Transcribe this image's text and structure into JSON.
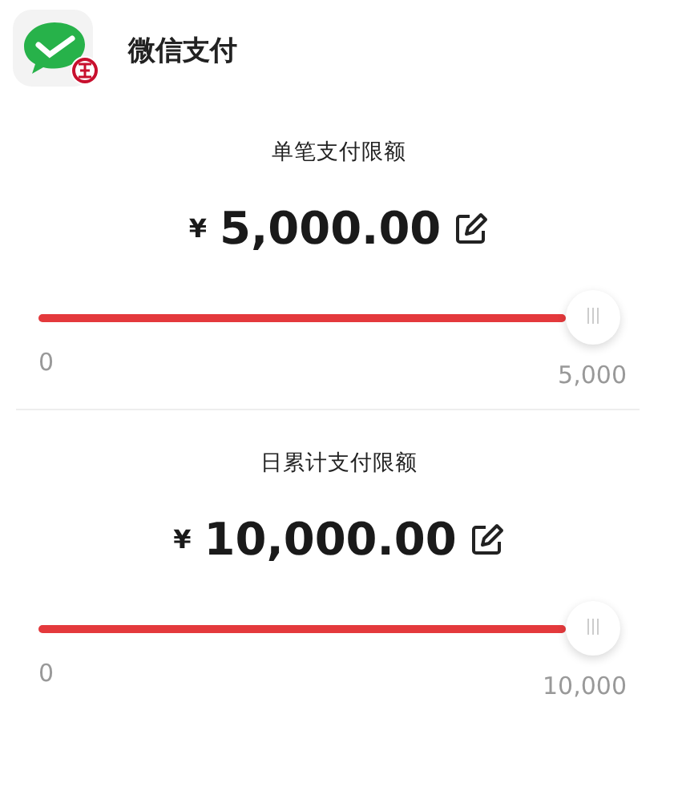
{
  "header": {
    "title": "微信支付"
  },
  "limits": [
    {
      "title": "单笔支付限额",
      "currency": "¥",
      "amount": "5,000.00",
      "level": 1,
      "min_label": "0",
      "max_label": "5,000"
    },
    {
      "title": "日累计支付限额",
      "currency": "¥",
      "amount": "10,000.00",
      "level": 1,
      "min_label": "0",
      "max_label": "10,000"
    }
  ]
}
